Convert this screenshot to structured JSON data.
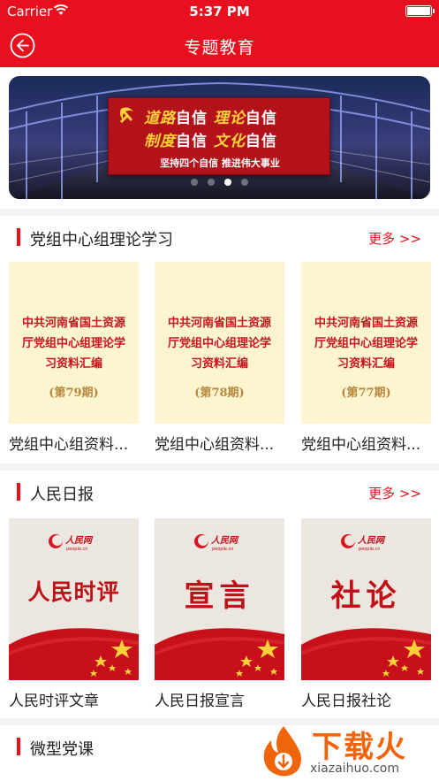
{
  "status": {
    "carrier": "Carrier",
    "time": "5:37 PM"
  },
  "nav": {
    "title": "专题教育"
  },
  "banner": {
    "line1_a": "道路",
    "line1_b": "自信",
    "line1_c": "理论",
    "line1_d": "自信",
    "line2_a": "制度",
    "line2_b": "自信",
    "line2_c": "文化",
    "line2_d": "自信",
    "tagline": "坚持四个自信 推进伟大事业",
    "active_dot": 2
  },
  "sections": [
    {
      "title": "党组中心组理论学习",
      "more": "更多 >>",
      "items": [
        {
          "cover_title": "中共河南省国土资源厅党组中心组理论学习资料汇编",
          "issue": "(第79期)",
          "caption": "党组中心组资料..."
        },
        {
          "cover_title": "中共河南省国土资源厅党组中心组理论学习资料汇编",
          "issue": "(第78期)",
          "caption": "党组中心组资料..."
        },
        {
          "cover_title": "中共河南省国土资源厅党组中心组理论学习资料汇编",
          "issue": "(第77期)",
          "caption": "党组中心组资料..."
        }
      ]
    },
    {
      "title": "人民日报",
      "more": "更多 >>",
      "items": [
        {
          "cover_title": "人民时评",
          "caption": "人民时评文章"
        },
        {
          "cover_title": "宣言",
          "caption": "人民日报宣言"
        },
        {
          "cover_title": "社论",
          "caption": "人民日报社论"
        }
      ]
    },
    {
      "title": "微型党课"
    }
  ],
  "logo": {
    "brand": "人民网",
    "sub": "people.cn"
  },
  "watermark": {
    "text": "下载火",
    "url": "xiazaihuo.com"
  },
  "colors": {
    "primary": "#e8101e",
    "booklet_bg": "#fdf4d0",
    "people_bg": "#ebe6df",
    "watermark": "#f0640a"
  }
}
